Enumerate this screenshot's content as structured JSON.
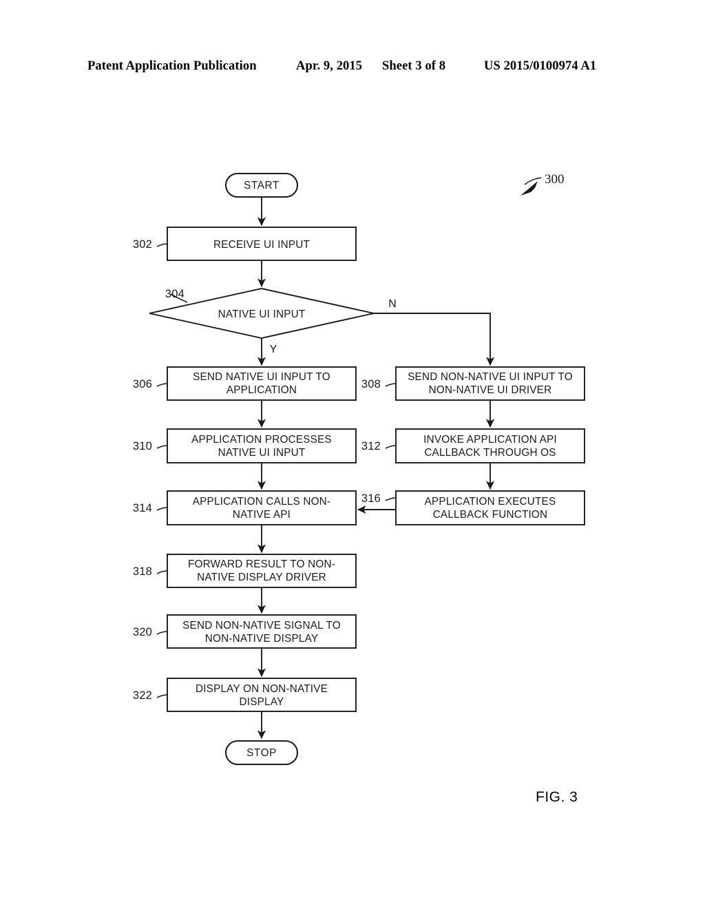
{
  "header": {
    "publication": "Patent Application Publication",
    "date": "Apr. 9, 2015",
    "sheet": "Sheet 3 of 8",
    "patent_number": "US 2015/0100974 A1"
  },
  "figure": {
    "label": "FIG. 3",
    "diagram_ref": "300"
  },
  "flowchart": {
    "start_label": "START",
    "stop_label": "STOP",
    "branch_yes": "Y",
    "branch_no": "N",
    "nodes": [
      {
        "ref": "",
        "type": "terminator",
        "lines": [
          "START"
        ]
      },
      {
        "ref": "302",
        "type": "process",
        "lines": [
          "RECEIVE UI INPUT"
        ]
      },
      {
        "ref": "304",
        "type": "decision",
        "lines": [
          "NATIVE UI INPUT"
        ]
      },
      {
        "ref": "306",
        "type": "process",
        "lines": [
          "SEND NATIVE UI INPUT TO",
          "APPLICATION"
        ]
      },
      {
        "ref": "308",
        "type": "process",
        "lines": [
          "SEND NON-NATIVE UI INPUT TO",
          "NON-NATIVE UI DRIVER"
        ]
      },
      {
        "ref": "310",
        "type": "process",
        "lines": [
          "APPLICATION PROCESSES",
          "NATIVE UI INPUT"
        ]
      },
      {
        "ref": "312",
        "type": "process",
        "lines": [
          "INVOKE APPLICATION API",
          "CALLBACK THROUGH OS"
        ]
      },
      {
        "ref": "314",
        "type": "process",
        "lines": [
          "APPLICATION CALLS NON-",
          "NATIVE API"
        ]
      },
      {
        "ref": "316",
        "type": "process",
        "lines": [
          "APPLICATION EXECUTES",
          "CALLBACK FUNCTION"
        ]
      },
      {
        "ref": "318",
        "type": "process",
        "lines": [
          "FORWARD RESULT TO NON-",
          "NATIVE DISPLAY DRIVER"
        ]
      },
      {
        "ref": "320",
        "type": "process",
        "lines": [
          "SEND NON-NATIVE SIGNAL TO",
          "NON-NATIVE DISPLAY"
        ]
      },
      {
        "ref": "322",
        "type": "process",
        "lines": [
          "DISPLAY ON NON-NATIVE",
          "DISPLAY"
        ]
      },
      {
        "ref": "",
        "type": "terminator",
        "lines": [
          "STOP"
        ]
      }
    ],
    "refs": {
      "r302": "302",
      "r304": "304",
      "r306": "306",
      "r308": "308",
      "r310": "310",
      "r312": "312",
      "r314": "314",
      "r316": "316",
      "r318": "318",
      "r320": "320",
      "r322": "322"
    },
    "text": {
      "t_start": "START",
      "t_302": "RECEIVE UI INPUT",
      "t_304": "NATIVE UI INPUT",
      "t_306_l1": "SEND NATIVE UI INPUT TO",
      "t_306_l2": "APPLICATION",
      "t_308_l1": "SEND NON-NATIVE UI INPUT TO",
      "t_308_l2": "NON-NATIVE UI DRIVER",
      "t_310_l1": "APPLICATION PROCESSES",
      "t_310_l2": "NATIVE UI INPUT",
      "t_312_l1": "INVOKE APPLICATION API",
      "t_312_l2": "CALLBACK THROUGH OS",
      "t_314_l1": "APPLICATION CALLS NON-",
      "t_314_l2": "NATIVE API",
      "t_316_l1": "APPLICATION EXECUTES",
      "t_316_l2": "CALLBACK FUNCTION",
      "t_318_l1": "FORWARD RESULT TO NON-",
      "t_318_l2": "NATIVE DISPLAY DRIVER",
      "t_320_l1": "SEND NON-NATIVE SIGNAL TO",
      "t_320_l2": "NON-NATIVE DISPLAY",
      "t_322_l1": "DISPLAY ON NON-NATIVE",
      "t_322_l2": "DISPLAY",
      "t_stop": "STOP",
      "t_yes": "Y",
      "t_no": "N",
      "t_300": "300"
    }
  },
  "colors": {
    "ink": "#1a1a1a",
    "paper": "#ffffff"
  }
}
